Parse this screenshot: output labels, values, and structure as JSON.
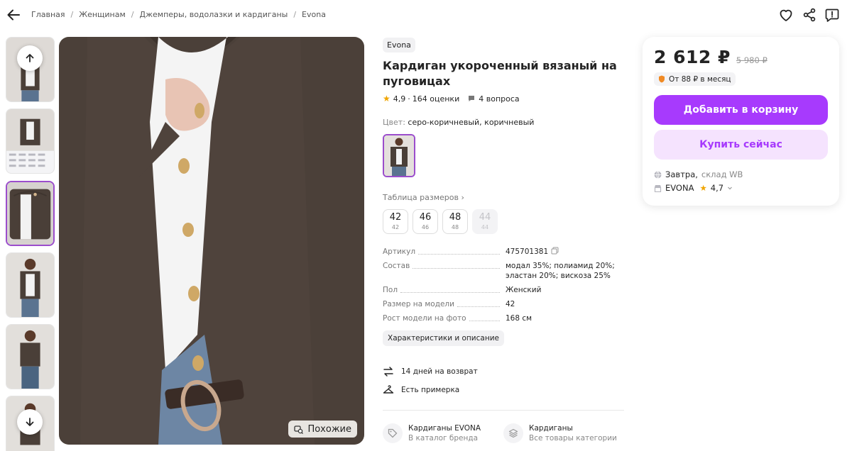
{
  "breadcrumbs": [
    "Главная",
    "Женщинам",
    "Джемперы, водолазки и кардиганы",
    "Evona"
  ],
  "product": {
    "brand": "Evona",
    "title_line1": "Кардиган укороченный вязаный на",
    "title_line2": "пуговицах",
    "rating": "4,9",
    "reviews": "164 оценки",
    "questions": "4 вопроса",
    "color_label": "Цвет:",
    "color_value": "серо-коричневый, коричневый",
    "size_table_label": "Таблица размеров",
    "sizes": [
      {
        "size": "42",
        "ru": "42",
        "available": true
      },
      {
        "size": "46",
        "ru": "46",
        "available": true
      },
      {
        "size": "48",
        "ru": "48",
        "available": true
      },
      {
        "size": "44",
        "ru": "44",
        "available": false
      }
    ],
    "specs": [
      {
        "key": "Артикул",
        "value": "475701381"
      },
      {
        "key": "Состав",
        "value": "модал 35%; полиамид 20%; эластан 20%; вискоза 25%"
      },
      {
        "key": "Пол",
        "value": "Женский"
      },
      {
        "key": "Размер на модели",
        "value": "42"
      },
      {
        "key": "Рост модели на фото",
        "value": "168 см"
      }
    ],
    "characteristics_button": "Характеристики и описание",
    "features": [
      "14 дней на возврат",
      "Есть примерка"
    ],
    "categories": [
      {
        "title": "Кардиганы EVONA",
        "subtitle": "В каталог бренда"
      },
      {
        "title": "Кардиганы",
        "subtitle": "Все товары категории"
      }
    ]
  },
  "gallery": {
    "similar_label": "Похожие",
    "active_thumb": 2,
    "thumb_count": 6
  },
  "buy_card": {
    "price": "2 612 ₽",
    "old_price": "5 980 ₽",
    "installment": "От 88 ₽ в месяц",
    "add_to_cart": "Добавить в корзину",
    "buy_now": "Купить сейчас",
    "delivery_day": "Завтра",
    "delivery_sep": ",",
    "warehouse": "склад WB",
    "seller_name": "EVONA",
    "seller_rating": "4,7"
  },
  "colors": {
    "accent": "#a73afd",
    "accent_light": "#f5e3fe",
    "star": "#f0a500",
    "cardigan": "#4a3f38"
  }
}
